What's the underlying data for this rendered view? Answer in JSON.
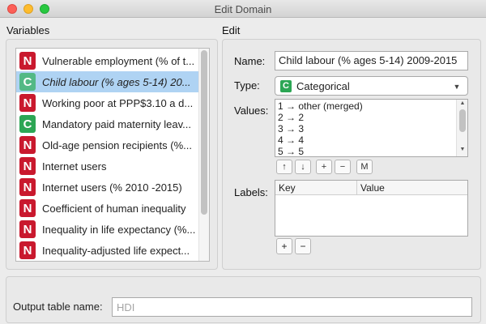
{
  "window": {
    "title": "Edit Domain"
  },
  "variables": {
    "section_label": "Variables",
    "items": [
      {
        "badge": "N",
        "label": "Vulnerable employment (% of t...",
        "selected": false
      },
      {
        "badge": "C",
        "label": "Child labour  (% ages 5-14) 20...",
        "selected": true
      },
      {
        "badge": "N",
        "label": "Working poor at PPP$3.10 a d...",
        "selected": false
      },
      {
        "badge": "C",
        "label": "Mandatory paid maternity leav...",
        "selected": false
      },
      {
        "badge": "N",
        "label": "Old-age pension recipients  (%...",
        "selected": false
      },
      {
        "badge": "N",
        "label": "Internet users",
        "selected": false
      },
      {
        "badge": "N",
        "label": "Internet users (% 2010 -2015)",
        "selected": false
      },
      {
        "badge": "N",
        "label": "Coefficient of human inequality",
        "selected": false
      },
      {
        "badge": "N",
        "label": "Inequality in life expectancy (%...",
        "selected": false
      },
      {
        "badge": "N",
        "label": "Inequality-adjusted life expect...",
        "selected": false
      }
    ]
  },
  "edit": {
    "section_label": "Edit",
    "name_label": "Name:",
    "name_value": "Child labour  (% ages 5-14) 2009-2015",
    "type_label": "Type:",
    "type_badge": "C",
    "type_value": "Categorical",
    "values_label": "Values:",
    "values": [
      "1 → other (merged)",
      "2 → 2",
      "3 → 3",
      "4 → 4",
      "5 → 5"
    ],
    "value_buttons": [
      "↑",
      "↓",
      "+",
      "−",
      "M"
    ],
    "labels_label": "Labels:",
    "labels_columns": [
      "Key",
      "Value"
    ],
    "labels_buttons": [
      "+",
      "−"
    ]
  },
  "output": {
    "label": "Output table name:",
    "placeholder": "HDI"
  }
}
